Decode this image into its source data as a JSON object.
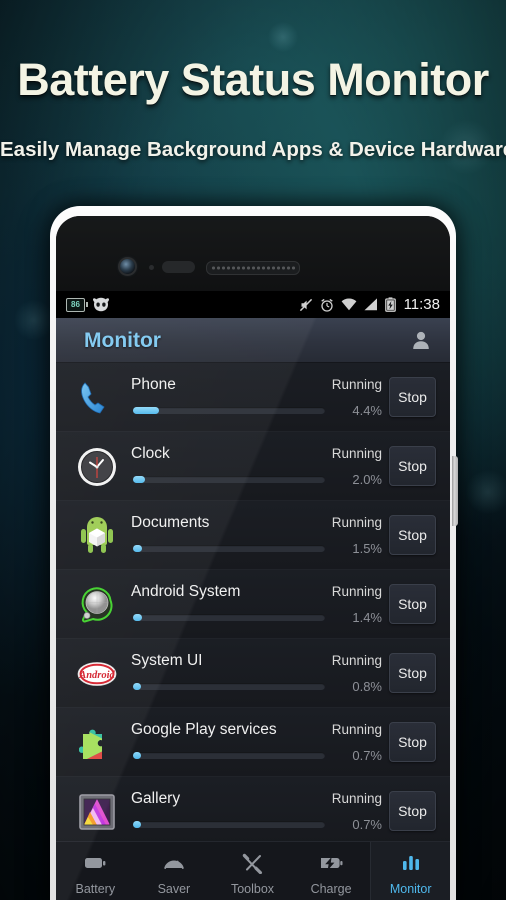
{
  "promo": {
    "title": "Battery Status Monitor",
    "subtitle": "Easily Manage Background Apps & Device Hardware"
  },
  "statusbar": {
    "battery_level_text": "86",
    "time": "11:38",
    "icons": [
      "battery-percent-icon",
      "cyanogenmod-icon",
      "mute-icon",
      "alarm-icon",
      "wifi-icon",
      "signal-icon",
      "battery-charging-icon"
    ]
  },
  "appbar": {
    "title": "Monitor",
    "avatar_icon": "person-icon"
  },
  "apps": [
    {
      "name": "Phone",
      "status": "Running",
      "percent": "4.4%",
      "bar_fill": 26,
      "icon": "phone-icon"
    },
    {
      "name": "Clock",
      "status": "Running",
      "percent": "2.0%",
      "bar_fill": 12,
      "icon": "clock-icon"
    },
    {
      "name": "Documents",
      "status": "Running",
      "percent": "1.5%",
      "bar_fill": 9,
      "icon": "android-documents-icon"
    },
    {
      "name": "Android System",
      "status": "Running",
      "percent": "1.4%",
      "bar_fill": 9,
      "icon": "android-system-icon"
    },
    {
      "name": "System UI",
      "status": "Running",
      "percent": "0.8%",
      "bar_fill": 8,
      "icon": "android-kitkat-icon"
    },
    {
      "name": "Google Play services",
      "status": "Running",
      "percent": "0.7%",
      "bar_fill": 8,
      "icon": "google-play-services-icon"
    },
    {
      "name": "Gallery",
      "status": "Running",
      "percent": "0.7%",
      "bar_fill": 8,
      "icon": "gallery-icon"
    }
  ],
  "stop_label": "Stop",
  "bottomnav": {
    "tabs": [
      {
        "label": "Battery",
        "icon": "battery-icon",
        "active": false
      },
      {
        "label": "Saver",
        "icon": "gauge-icon",
        "active": false
      },
      {
        "label": "Toolbox",
        "icon": "tools-icon",
        "active": false
      },
      {
        "label": "Charge",
        "icon": "charge-icon",
        "active": false
      },
      {
        "label": "Monitor",
        "icon": "bars-icon",
        "active": true
      }
    ]
  },
  "colors": {
    "accent": "#4fb8ec",
    "title_accent": "#7ec8f0",
    "promo_text": "#f4f4e4",
    "app_bg": "#17191e"
  }
}
